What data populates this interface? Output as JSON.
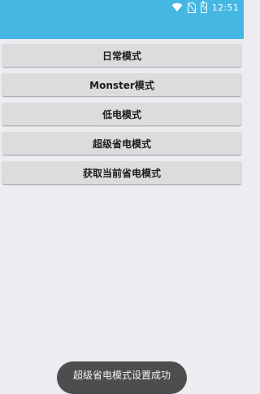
{
  "status_bar": {
    "time": "12:51",
    "icons": [
      "wifi-icon",
      "no-sim-icon",
      "battery-charging-icon"
    ]
  },
  "buttons": [
    {
      "label": "日常模式"
    },
    {
      "label": "Monster模式"
    },
    {
      "label": "低电模式"
    },
    {
      "label": "超级省电模式"
    },
    {
      "label": "获取当前省电模式"
    }
  ],
  "toast": {
    "text": "超级省电模式设置成功"
  },
  "colors": {
    "app_bar": "#45b7e3",
    "background": "#efecf1",
    "button": "#dcdcdc",
    "toast": "#4d4d4d"
  }
}
